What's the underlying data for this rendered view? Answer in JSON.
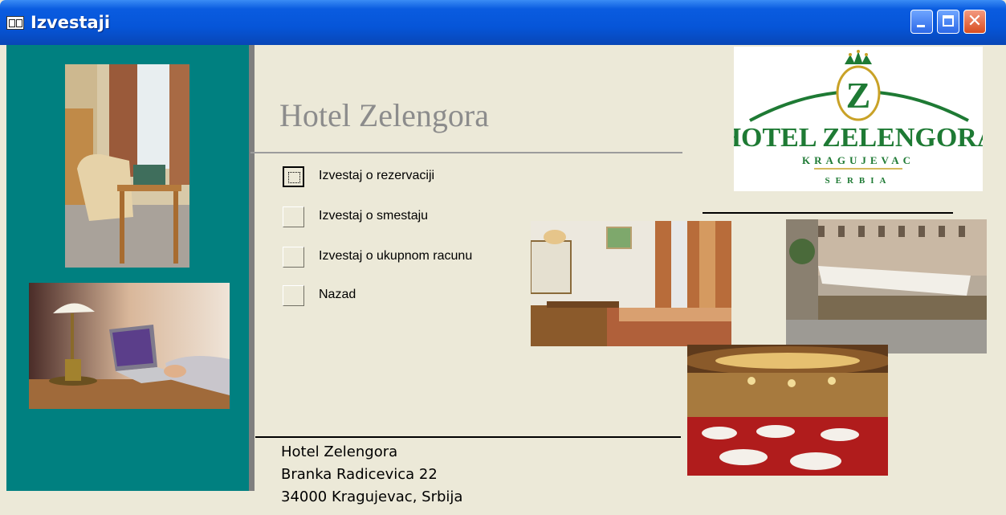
{
  "window": {
    "title": "Izvestaji"
  },
  "heading": "Hotel Zelengora",
  "menu": [
    {
      "label": "Izvestaj o rezervaciji"
    },
    {
      "label": "Izvestaj o smestaju"
    },
    {
      "label": "Izvestaj o ukupnom racunu"
    },
    {
      "label": "Nazad"
    }
  ],
  "footer": {
    "name": "Hotel Zelengora",
    "street": "Branka Radicevica 22",
    "city": "34000 Kragujevac, Srbija"
  },
  "logo": {
    "letter": "Z",
    "name": "HOTEL ZELENGORA",
    "city": "KRAGUJEVAC",
    "country": "SERBIA"
  },
  "colors": {
    "teal_panel": "#008080",
    "logo_green": "#1e7a34",
    "logo_gold": "#c9a227"
  }
}
